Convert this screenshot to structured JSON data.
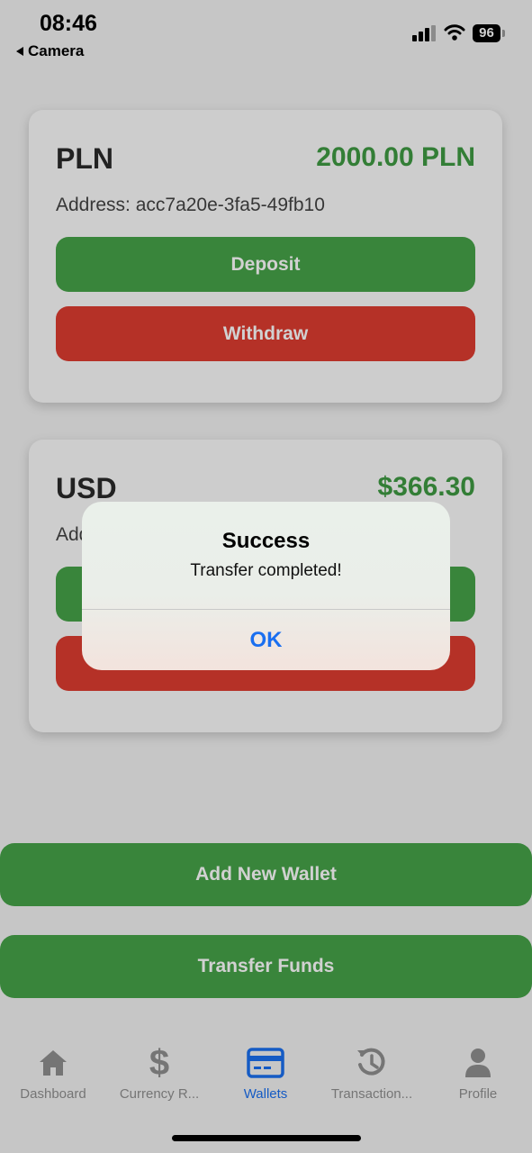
{
  "status_bar": {
    "time": "08:46",
    "back_label": "Camera",
    "battery": "96"
  },
  "wallets": [
    {
      "currency": "PLN",
      "balance": "2000.00 PLN",
      "address": "Address: acc7a20e-3fa5-49fb10",
      "deposit_label": "Deposit",
      "withdraw_label": "Withdraw"
    },
    {
      "currency": "USD",
      "balance": "$366.30",
      "address": "Add",
      "deposit_label": "",
      "withdraw_label": ""
    }
  ],
  "actions": {
    "add_wallet_label": "Add New Wallet",
    "transfer_label": "Transfer Funds"
  },
  "tabs": [
    {
      "label": "Dashboard",
      "icon": "home-icon"
    },
    {
      "label": "Currency R...",
      "icon": "dollar-icon"
    },
    {
      "label": "Wallets",
      "icon": "card-icon"
    },
    {
      "label": "Transaction...",
      "icon": "history-icon"
    },
    {
      "label": "Profile",
      "icon": "person-icon"
    }
  ],
  "active_tab": "Wallets",
  "alert": {
    "title": "Success",
    "message": "Transfer completed!",
    "ok_label": "OK"
  },
  "colors": {
    "green": "#46a349",
    "red": "#dd3c30",
    "accent": "#1a6ff0",
    "tab_inactive": "#8f8f8f"
  }
}
